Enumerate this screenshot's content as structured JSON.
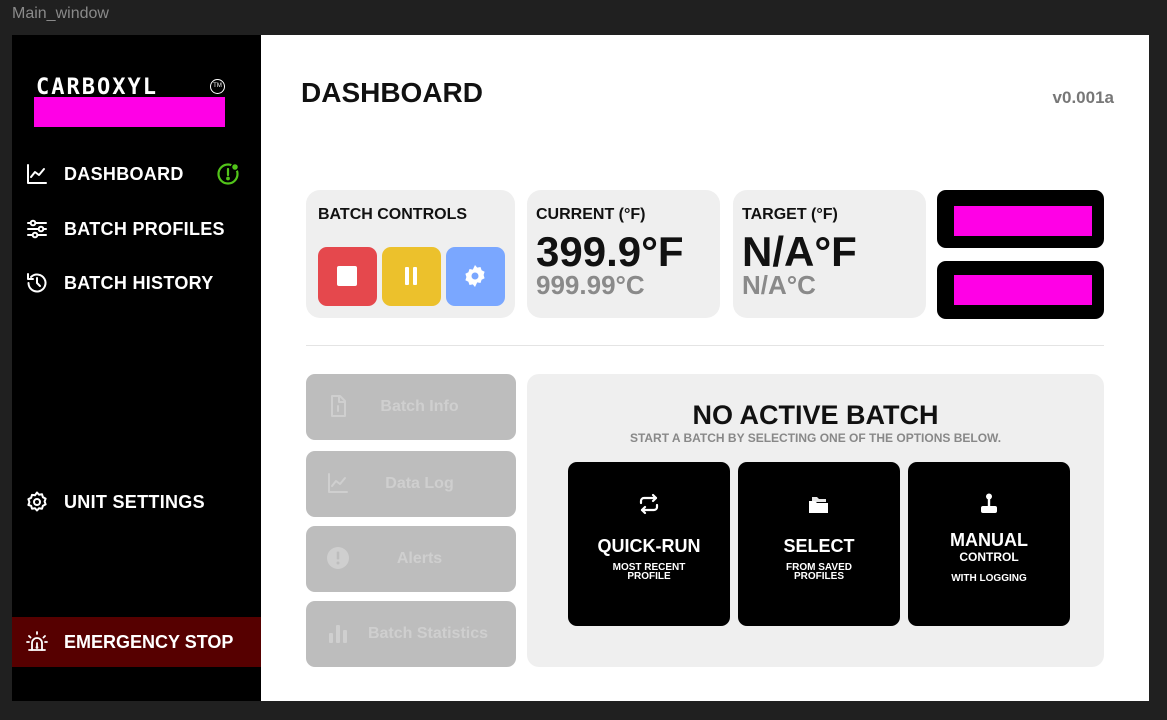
{
  "window": {
    "title": "Main_window"
  },
  "logo": {
    "text": "CARBOXYL",
    "tm": "TM"
  },
  "sidebar": {
    "items": [
      {
        "label": "DASHBOARD",
        "icon": "chart-line-icon"
      },
      {
        "label": "BATCH PROFILES",
        "icon": "sliders-icon"
      },
      {
        "label": "BATCH HISTORY",
        "icon": "history-icon"
      }
    ],
    "settings_label": "UNIT SETTINGS",
    "estop_label": "EMERGENCY STOP"
  },
  "header": {
    "title": "DASHBOARD",
    "version": "v0.001a"
  },
  "batch_controls": {
    "title": "BATCH CONTROLS"
  },
  "current": {
    "title": "CURRENT (°F)",
    "fahrenheit": "399.9°F",
    "celsius": "999.99°C"
  },
  "target": {
    "title": "TARGET (°F)",
    "fahrenheit": "N/A°F",
    "celsius": "N/A°C"
  },
  "side_buttons": [
    {
      "label": "Batch Info",
      "icon": "document-icon"
    },
    {
      "label": "Data Log",
      "icon": "chart-icon"
    },
    {
      "label": "Alerts",
      "icon": "alert-icon"
    },
    {
      "label": "Batch Statistics",
      "icon": "bar-chart-icon"
    }
  ],
  "batch": {
    "heading": "NO ACTIVE BATCH",
    "subheading": "START A BATCH BY SELECTING ONE OF THE OPTIONS BELOW.",
    "options": [
      {
        "title": "QUICK-RUN",
        "line1": "MOST RECENT",
        "line2": "PROFILE"
      },
      {
        "title": "SELECT",
        "line1": "FROM SAVED",
        "line2": "PROFILES"
      },
      {
        "title": "MANUAL",
        "line1": "CONTROL",
        "line2": "WITH LOGGING"
      }
    ]
  },
  "colors": {
    "accent": "#ff00e6",
    "stop": "#e5484d",
    "pause": "#ecc12c",
    "settings": "#7aa7ff",
    "estop_bg": "#560000",
    "badge": "#52c41a"
  }
}
